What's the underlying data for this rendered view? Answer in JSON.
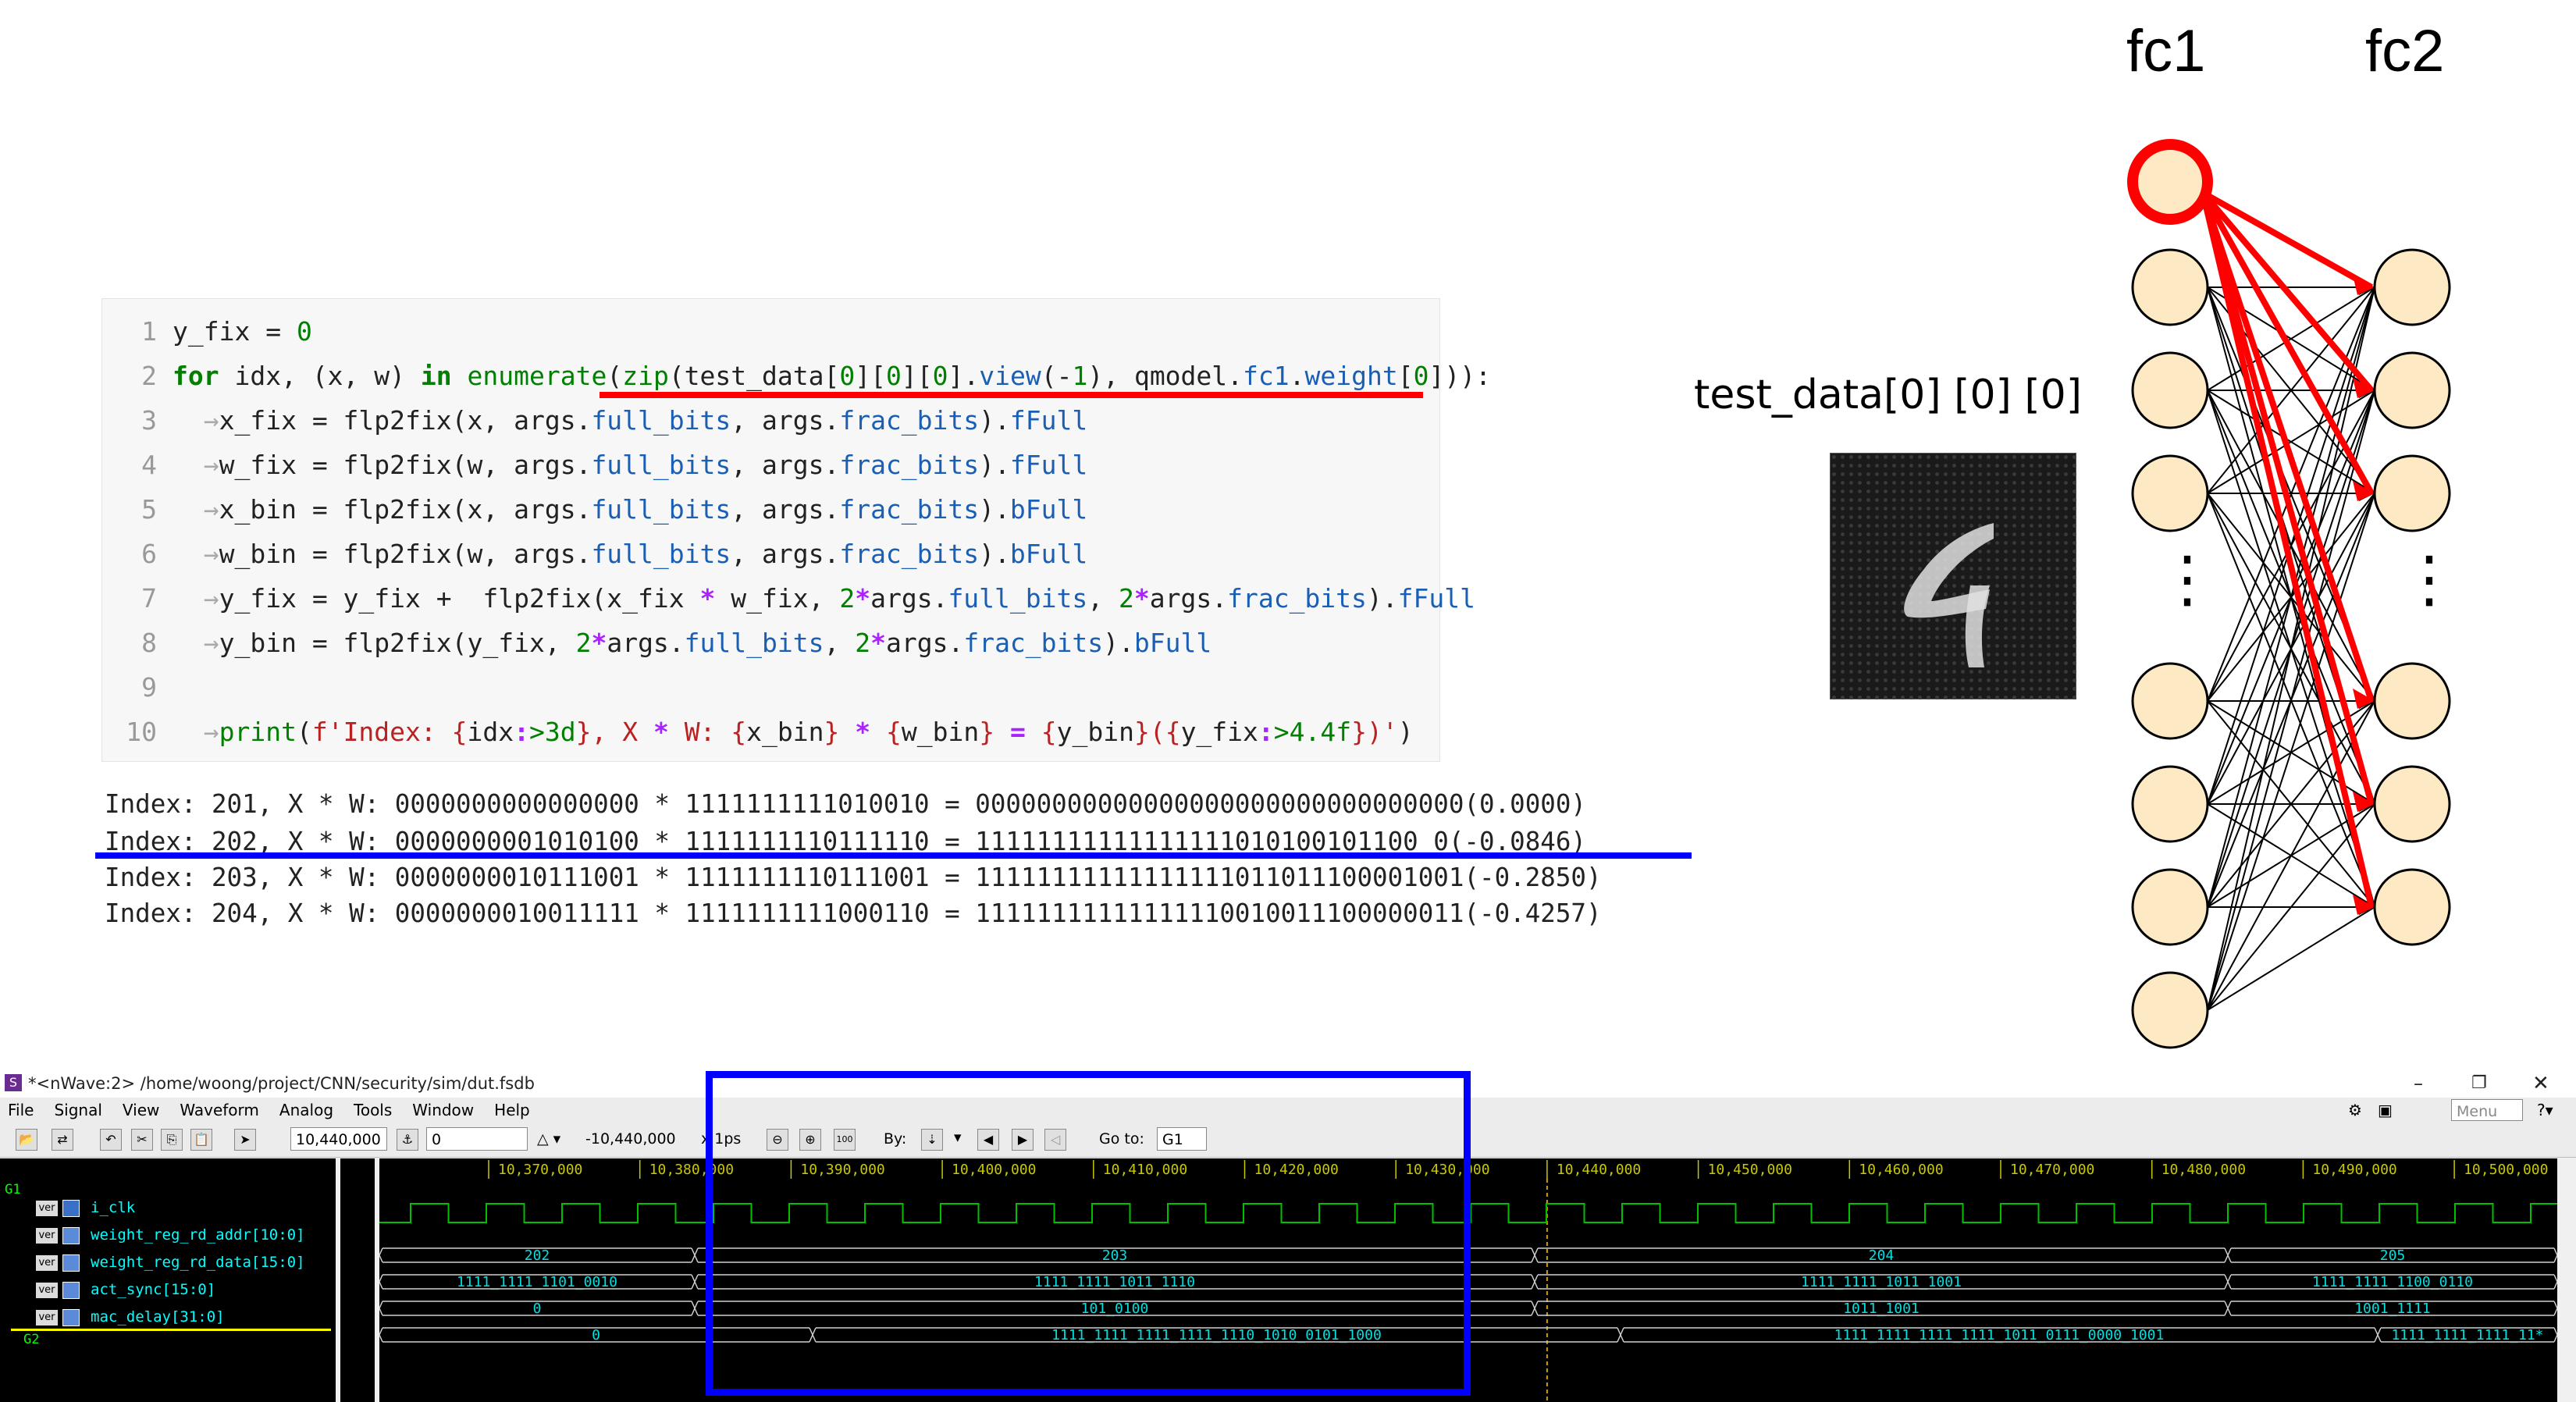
{
  "code": {
    "lines": [
      {
        "n": "1",
        "text": "y_fix = 0"
      },
      {
        "n": "2",
        "text": "for idx, (x, w) in enumerate(zip(test_data[0][0][0].view(-1), qmodel.fc1.weight[0])):"
      },
      {
        "n": "3",
        "text": "x_fix = flp2fix(x, args.full_bits, args.frac_bits).fFull"
      },
      {
        "n": "4",
        "text": "w_fix = flp2fix(w, args.full_bits, args.frac_bits).fFull"
      },
      {
        "n": "5",
        "text": "x_bin = flp2fix(x, args.full_bits, args.frac_bits).bFull"
      },
      {
        "n": "6",
        "text": "w_bin = flp2fix(w, args.full_bits, args.frac_bits).bFull"
      },
      {
        "n": "7",
        "text": "y_fix = y_fix +  flp2fix(x_fix * w_fix, 2*args.full_bits, 2*args.frac_bits).fFull"
      },
      {
        "n": "8",
        "text": "y_bin = flp2fix(y_fix, 2*args.full_bits, 2*args.frac_bits).bFull"
      },
      {
        "n": "9",
        "text": ""
      },
      {
        "n": "10",
        "text": "print(f'Index: {idx:>3d}, X * W: {x_bin} * {w_bin} = {y_bin}({y_fix:>4.4f})')"
      }
    ]
  },
  "output": [
    "Index: 201, X * W: 0000000000000000 * 1111111111010010 = 00000000000000000000000000000000(0.0000)",
    "Index: 202, X * W: 0000000001010100 * 1111111110111110 = 11111111111111111010100101100 0(-0.0846)",
    "Index: 203, X * W: 0000000010111001 * 1111111110111001 = 11111111111111111011011100001001(-0.2850)",
    "Index: 204, X * W: 0000000010011111 * 1111111111000110 = 11111111111111110010011100000011(-0.4257)"
  ],
  "diagram": {
    "fc1_label": "fc1",
    "fc2_label": "fc2",
    "input_label": "test_data[0] [0] [0]",
    "ellipsis": "⋮"
  },
  "nwave": {
    "title": "*<nWave:2> /home/woong/project/CNN/security/sim/dut.fsdb",
    "menu": [
      "File",
      "Signal",
      "View",
      "Waveform",
      "Analog",
      "Tools",
      "Window",
      "Help"
    ],
    "cursor_time": "10,440,000",
    "marker_time": "0",
    "delta_time": "-10,440,000",
    "time_unit": "x 1ps",
    "by_label": "By:",
    "goto_label": "Go to:",
    "goto_value": "G1",
    "menu_search_placeholder": "Menu",
    "group1": "G1",
    "group2": "G2",
    "signals": [
      {
        "ver": "ver",
        "name": "i_clk"
      },
      {
        "ver": "ver",
        "name": "weight_reg_rd_addr[10:0]"
      },
      {
        "ver": "ver",
        "name": "weight_reg_rd_data[15:0]"
      },
      {
        "ver": "ver",
        "name": "act_sync[15:0]"
      },
      {
        "ver": "ver",
        "name": "mac_delay[31:0]"
      }
    ],
    "time_ticks": [
      "10,370,000",
      "10,380,000",
      "10,390,000",
      "10,400,000",
      "10,410,000",
      "10,420,000",
      "10,430,000",
      "10,440,000",
      "10,450,000",
      "10,460,000",
      "10,470,000",
      "10,480,000",
      "10,490,000",
      "10,500,000"
    ],
    "bus_values": {
      "addr": [
        "202",
        "203",
        "204",
        "205"
      ],
      "data": [
        "1111_1111_1101_0010",
        "1111_1111_1011_1110",
        "1111_1111_1011_1001",
        "1111_1111_1100_0110"
      ],
      "act": [
        "0",
        "101_0100",
        "1011_1001",
        "1001_1111"
      ],
      "mac": [
        "0",
        "1111_1111_1111_1111_1110_1010_0101_1000",
        "1111_1111_1111_1111_1011_0111_0000_1001",
        "1111_1111_1111_11*"
      ]
    }
  },
  "colors": {
    "highlight_red": "#ff0000",
    "highlight_blue": "#0000ff",
    "node_fill": "#fde9c4",
    "wave_green": "#00c000",
    "wave_cyan": "#00e0e0"
  }
}
